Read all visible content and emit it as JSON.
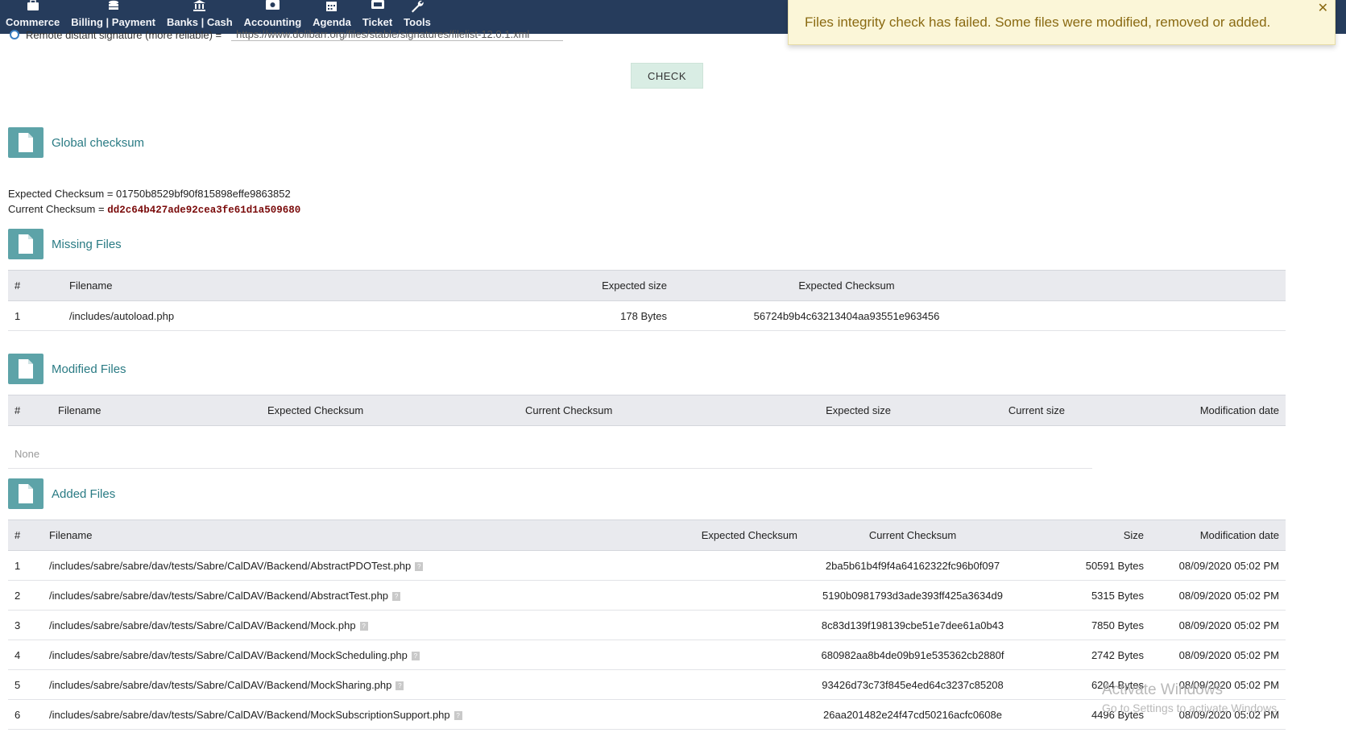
{
  "nav": [
    {
      "label": "Commerce",
      "icon": "briefcase-icon"
    },
    {
      "label": "Billing | Payment",
      "icon": "coins-icon"
    },
    {
      "label": "Banks | Cash",
      "icon": "bank-icon"
    },
    {
      "label": "Accounting",
      "icon": "money-icon"
    },
    {
      "label": "Agenda",
      "icon": "calendar-icon"
    },
    {
      "label": "Ticket",
      "icon": "ticket-icon"
    },
    {
      "label": "Tools",
      "icon": "wrench-icon"
    }
  ],
  "signature": {
    "label": "Remote distant signature (more reliable) =",
    "url": "https://www.dolibarr.org/files/stable/signatures/filelist-12.0.1.xml"
  },
  "check_button": "CHECK",
  "global": {
    "title": "Global checksum",
    "expected_label": "Expected Checksum = ",
    "expected_value": "01750b8529bf90f815898effe9863852",
    "current_label": "Current Checksum = ",
    "current_value": "dd2c64b427ade92cea3fe61d1a509680"
  },
  "missing": {
    "title": "Missing Files",
    "headers": [
      "#",
      "Filename",
      "Expected size",
      "Expected Checksum"
    ],
    "rows": [
      {
        "num": "1",
        "filename": "/includes/autoload.php",
        "expected_size": "178 Bytes",
        "expected_checksum": "56724b9b4c63213404aa93551e963456"
      }
    ]
  },
  "modified": {
    "title": "Modified Files",
    "headers": [
      "#",
      "Filename",
      "Expected Checksum",
      "Current Checksum",
      "Expected size",
      "Current size",
      "Modification date"
    ],
    "empty": "None"
  },
  "added": {
    "title": "Added Files",
    "headers": [
      "#",
      "Filename",
      "Expected Checksum",
      "Current Checksum",
      "Size",
      "Modification date"
    ],
    "rows": [
      {
        "num": "1",
        "filename": "/includes/sabre/sabre/dav/tests/Sabre/CalDAV/Backend/AbstractPDOTest.php",
        "checksum": "2ba5b61b4f9f4a64162322fc96b0f097",
        "size": "50591 Bytes",
        "date": "08/09/2020 05:02 PM"
      },
      {
        "num": "2",
        "filename": "/includes/sabre/sabre/dav/tests/Sabre/CalDAV/Backend/AbstractTest.php",
        "checksum": "5190b0981793d3ade393ff425a3634d9",
        "size": "5315 Bytes",
        "date": "08/09/2020 05:02 PM"
      },
      {
        "num": "3",
        "filename": "/includes/sabre/sabre/dav/tests/Sabre/CalDAV/Backend/Mock.php",
        "checksum": "8c83d139f198139cbe51e7dee61a0b43",
        "size": "7850 Bytes",
        "date": "08/09/2020 05:02 PM"
      },
      {
        "num": "4",
        "filename": "/includes/sabre/sabre/dav/tests/Sabre/CalDAV/Backend/MockScheduling.php",
        "checksum": "680982aa8b4de09b91e535362cb2880f",
        "size": "2742 Bytes",
        "date": "08/09/2020 05:02 PM"
      },
      {
        "num": "5",
        "filename": "/includes/sabre/sabre/dav/tests/Sabre/CalDAV/Backend/MockSharing.php",
        "checksum": "93426d73c73f845e4ed64c3237c85208",
        "size": "6204 Bytes",
        "date": "08/09/2020 05:02 PM"
      },
      {
        "num": "6",
        "filename": "/includes/sabre/sabre/dav/tests/Sabre/CalDAV/Backend/MockSubscriptionSupport.php",
        "checksum": "26aa201482e24f47cd50216acfc0608e",
        "size": "4496 Bytes",
        "date": "08/09/2020 05:02 PM"
      }
    ]
  },
  "toast": "Files integrity check has failed. Some files were modified, removed or added.",
  "watermark": {
    "line1": "Activate Windows",
    "line2": "Go to Settings to activate Windows."
  }
}
